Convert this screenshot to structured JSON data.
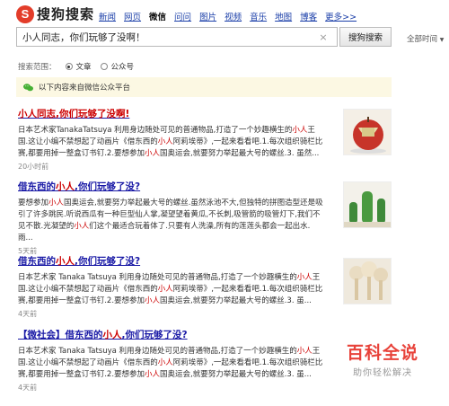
{
  "logo": {
    "mark": "S",
    "text": "搜狗搜索"
  },
  "nav": [
    "新闻",
    "网页",
    "微信",
    "问问",
    "图片",
    "视频",
    "音乐",
    "地图",
    "博客",
    "更多>>"
  ],
  "nav_active": "微信",
  "search": {
    "value": "小人同志，你们玩够了没啊！",
    "button": "搜狗搜索",
    "clear": "×"
  },
  "time_filter": {
    "label": "全部时间",
    "caret": "▼"
  },
  "scope": {
    "label": "搜索范围：",
    "options": [
      "文章",
      "公众号"
    ],
    "selected": "文章"
  },
  "notice": "以下内容来自微信公众平台",
  "results": [
    {
      "title_parts": [
        {
          "t": "小人同志,你们玩够了没啊!",
          "hl": true
        }
      ],
      "body_parts": [
        {
          "t": "日本艺术家TanakaTatsuya 利用身边随处可见的普通物品,打造了一个妙趣横生的"
        },
        {
          "t": "小人",
          "hl": true
        },
        {
          "t": "王国.这让小编不禁想起了动画片《借东西的"
        },
        {
          "t": "小人",
          "hl": true
        },
        {
          "t": "阿莉埃蒂》,一起来看看吧.1.每次组织骑栏比赛,都要用掉一整盒订书钉.2.要想参加"
        },
        {
          "t": "小人",
          "hl": true
        },
        {
          "t": "国奥运会,就要努力举起最大号的螺丝.3. 虽然..."
        }
      ],
      "meta": "20小时前"
    },
    {
      "title_parts": [
        {
          "t": "借东西的"
        },
        {
          "t": "小人",
          "hl": true
        },
        {
          "t": ",你们玩够了没?"
        }
      ],
      "body_parts": [
        {
          "t": "要想参加"
        },
        {
          "t": "小人",
          "hl": true
        },
        {
          "t": "国奥运会,就要努力举起最大号的螺丝.虽然泳池不大,但独特的拼图造型还是吸引了许多跳民.听说西瓜有一种巨型仙人掌,凝望望着黄瓜,不长刺,吸管箭的吸管灯下,我们不见不散.光凝望的"
        },
        {
          "t": "小人",
          "hl": true
        },
        {
          "t": "们这个最适合玩着体了.只要有人洗澡,所有的莲莲头都会一起出水.雨..."
        }
      ],
      "meta": "5天前"
    },
    {
      "title_parts": [
        {
          "t": "借东西的"
        },
        {
          "t": "小人",
          "hl": true
        },
        {
          "t": ",你们玩够了没?"
        }
      ],
      "body_parts": [
        {
          "t": "日本艺术家 Tanaka Tatsuya 利用身边随处可见的普通物品,打造了一个妙趣横生的"
        },
        {
          "t": "小人",
          "hl": true
        },
        {
          "t": "王国.这让小编不禁想起了动画片《借东西的"
        },
        {
          "t": "小人",
          "hl": true
        },
        {
          "t": "阿莉埃蒂》,一起来看看吧.1.每次组织骑栏比赛,都要用掉一整盒订书钉.2.要想参加"
        },
        {
          "t": "小人",
          "hl": true
        },
        {
          "t": "国奥运会,就要努力举起最大号的螺丝.3. 虽..."
        }
      ],
      "meta": "4天前"
    },
    {
      "title_parts": [
        {
          "t": "【微社会】",
          "tag": true
        },
        {
          "t": "借东西的"
        },
        {
          "t": "小人",
          "hl": true
        },
        {
          "t": ",你们玩够了没?"
        }
      ],
      "body_parts": [
        {
          "t": "日本艺术家 Tanaka Tatsuya 利用身边随处可见的普通物品,打造了一个妙趣横生的"
        },
        {
          "t": "小人",
          "hl": true
        },
        {
          "t": "王国.这让小编不禁想起了动画片《借东西的"
        },
        {
          "t": "小人",
          "hl": true
        },
        {
          "t": "阿莉埃蒂》,一起来看看吧.1.每次组织骑栏比赛,都要用掉一整盒订书钉.2.要想参加"
        },
        {
          "t": "小人",
          "hl": true
        },
        {
          "t": "国奥运会,就要努力举起最大号的螺丝.3. 虽..."
        }
      ],
      "meta": "4天前"
    }
  ],
  "watermark": {
    "main": "百科全说",
    "sub": "助你轻松解决"
  },
  "colors": {
    "link": "#1a1aa6",
    "highlight": "#cc0000",
    "brand": "#e33d2a",
    "notice_bg": "#fcf8e3"
  }
}
